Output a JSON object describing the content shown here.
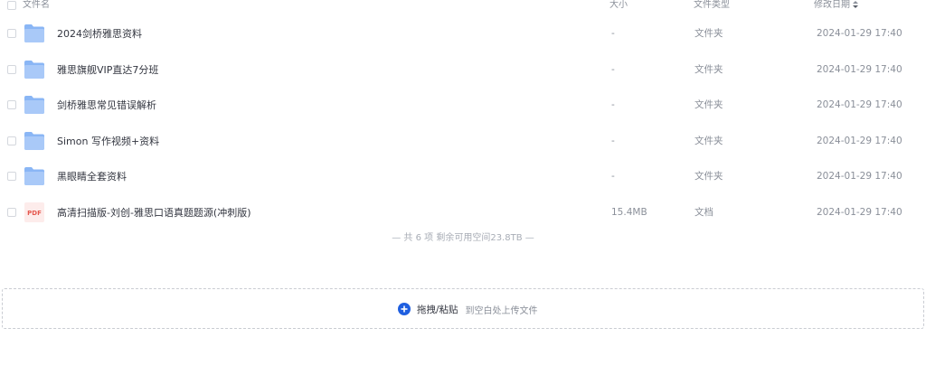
{
  "header": {
    "name": "文件名",
    "size": "大小",
    "type": "文件类型",
    "date": "修改日期"
  },
  "files": [
    {
      "name": "2024剑桥雅思资料",
      "size": "-",
      "type": "文件夹",
      "date": "2024-01-29 17:40",
      "icon": "folder-icon"
    },
    {
      "name": "雅思旗舰VIP直达7分班",
      "size": "-",
      "type": "文件夹",
      "date": "2024-01-29 17:40",
      "icon": "folder-icon"
    },
    {
      "name": "剑桥雅思常见错误解析",
      "size": "-",
      "type": "文件夹",
      "date": "2024-01-29 17:40",
      "icon": "folder-icon"
    },
    {
      "name": "Simon 写作视频+资料",
      "size": "-",
      "type": "文件夹",
      "date": "2024-01-29 17:40",
      "icon": "folder-icon"
    },
    {
      "name": "黑眼睛全套资料",
      "size": "-",
      "type": "文件夹",
      "date": "2024-01-29 17:40",
      "icon": "folder-icon"
    },
    {
      "name": "高清扫描版-刘创-雅思口语真题题源(冲刺版)",
      "size": "15.4MB",
      "type": "文档",
      "date": "2024-01-29 17:40",
      "icon": "pdf-icon",
      "icon_label": "PDF"
    }
  ],
  "summary": "— 共 6 项 剩余可用空间23.8TB —",
  "upload": {
    "main": "拖拽/粘贴",
    "sub": "到空白处上传文件"
  },
  "colors": {
    "folder": "#8ab6f5",
    "folder_tab": "#a9c9f8",
    "pdf_bg": "#fdeceb",
    "pdf_text": "#e5584f",
    "accent": "#1f5fe0"
  }
}
